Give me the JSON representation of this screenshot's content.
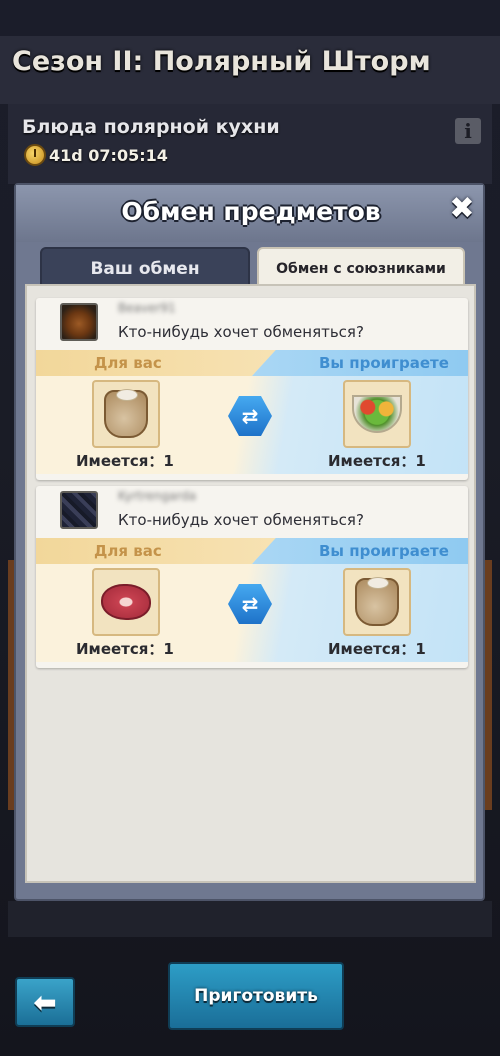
{
  "header": {
    "season_title": "Сезон II: Полярный Шторм"
  },
  "event": {
    "title": "Блюда полярной кухни",
    "timer": "41d 07:05:14",
    "info_icon": "info-icon"
  },
  "modal": {
    "title": "Обмен предметов",
    "close_icon": "close-icon",
    "tabs": [
      {
        "label": "Ваш обмен",
        "active": false
      },
      {
        "label": "Обмен с союзниками",
        "active": true
      }
    ]
  },
  "offers": [
    {
      "username": "Beaver91",
      "avatar": "beaver-avatar",
      "message": "Кто-нибудь хочет обменяться?",
      "for_you_label": "Для вас",
      "you_lose_label": "Вы проиграете",
      "give_item": "flour-sack-icon",
      "give_count": "Имеется：1",
      "take_item": "salad-bowl-icon",
      "take_count": "Имеется：1"
    },
    {
      "username": "Kyrtrengarda",
      "avatar": "dark-avatar",
      "message": "Кто-нибудь хочет обменяться?",
      "for_you_label": "Для вас",
      "you_lose_label": "Вы проиграете",
      "give_item": "meat-steak-icon",
      "give_count": "Имеется：1",
      "take_item": "flour-sack-icon",
      "take_count": "Имеется：1"
    }
  ],
  "footer": {
    "back_icon": "arrow-left-icon",
    "cook_label": "Приготовить"
  },
  "colors": {
    "modal_header": "#8c96ad",
    "for_you_text": "#c4934a",
    "you_lose_text": "#3f8ed0",
    "button_blue": "#2d9dc6"
  }
}
